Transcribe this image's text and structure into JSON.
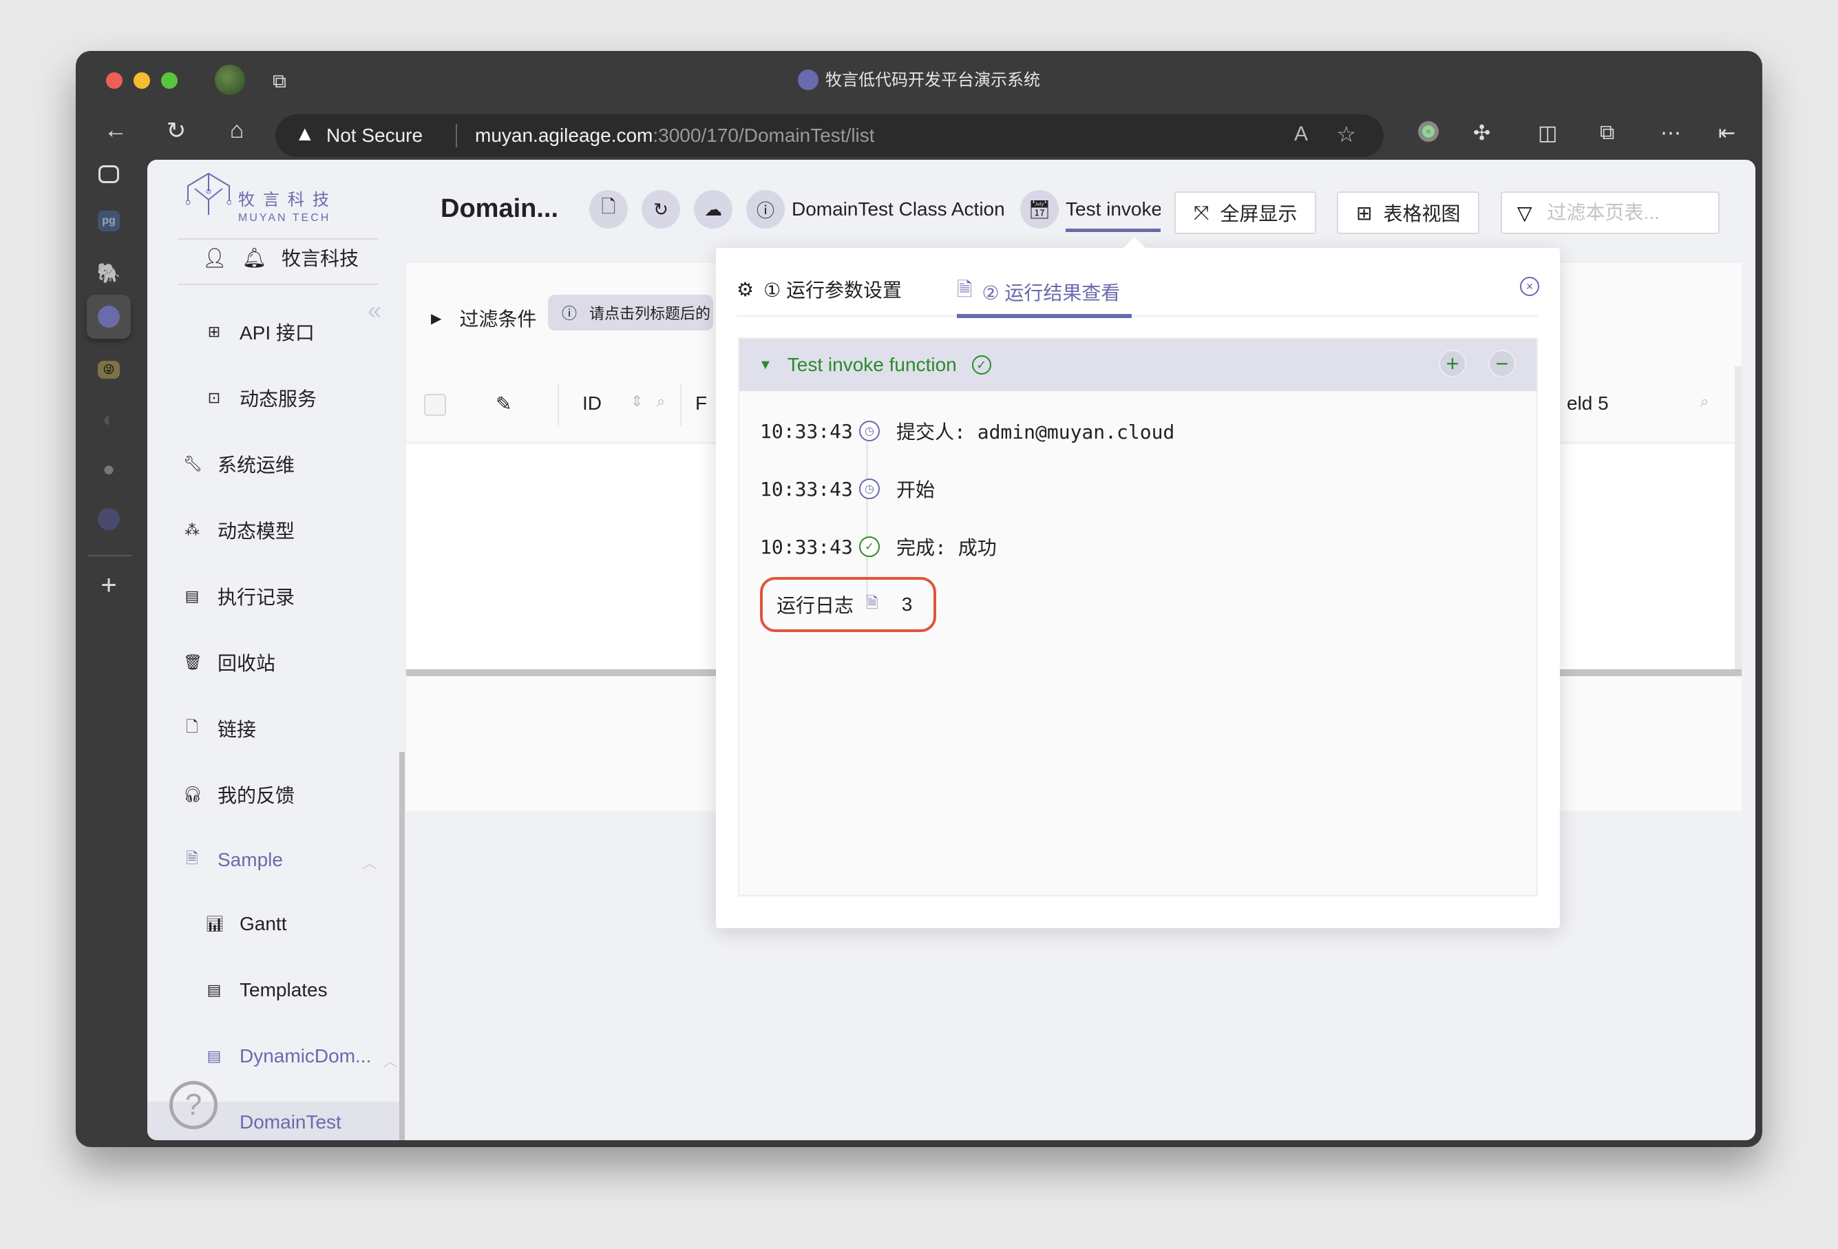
{
  "browser": {
    "window_title": "牧言低代码开发平台演示系统",
    "security_label": "Not Secure",
    "url_host": "muyan.agileage.com",
    "url_path": ":3000/170/DomainTest/list"
  },
  "vertical_tabs": [
    "sidebar-toggle",
    "pg",
    "postgres",
    "muyan",
    "emoji",
    "chat",
    "github",
    "muyan-2",
    "new-tab"
  ],
  "sidebar": {
    "logo_cn": "牧言科技",
    "logo_en": "MUYAN TECH",
    "user_name": "牧言科技",
    "items": [
      {
        "label": "API 接口",
        "icon": "sliders-icon",
        "level": "sub"
      },
      {
        "label": "动态服务",
        "icon": "terminal-icon",
        "level": "sub"
      },
      {
        "label": "系统运维",
        "icon": "wrench-icon",
        "level": "top"
      },
      {
        "label": "动态模型",
        "icon": "nodes-icon",
        "level": "top"
      },
      {
        "label": "执行记录",
        "icon": "clipboard-icon",
        "level": "top"
      },
      {
        "label": "回收站",
        "icon": "trash-icon",
        "level": "top"
      },
      {
        "label": "链接",
        "icon": "file-link-icon",
        "level": "top"
      },
      {
        "label": "我的反馈",
        "icon": "headphones-icon",
        "level": "top"
      },
      {
        "label": "Sample",
        "icon": "document-icon",
        "level": "top",
        "expanded": true
      },
      {
        "label": "Gantt",
        "icon": "bar-chart-icon",
        "level": "sub"
      },
      {
        "label": "Templates",
        "icon": "template-icon",
        "level": "sub"
      },
      {
        "label": "DynamicDom...",
        "icon": "template-icon",
        "level": "sub",
        "expanded": true
      },
      {
        "label": "DomainTest",
        "level": "sub",
        "active": true
      }
    ]
  },
  "header": {
    "title": "Domain...",
    "actions": [
      {
        "name": "new",
        "icon": "file-plus-icon"
      },
      {
        "name": "refresh",
        "icon": "refresh-icon"
      },
      {
        "name": "upload",
        "icon": "cloud-upload-icon"
      }
    ],
    "class_action_label": "DomainTest Class Action",
    "test_invoke_label": "Test invoke",
    "fullscreen_label": "全屏显示",
    "table_view_label": "表格视图",
    "filter_placeholder": "过滤本页表..."
  },
  "list": {
    "filter_label": "过滤条件",
    "hint_text": "请点击列标题后的",
    "columns": [
      "ID",
      "F",
      "eld 5"
    ]
  },
  "popup": {
    "tab1_label": "① 运行参数设置",
    "tab2_label": "② 运行结果查看",
    "active_tab": 2,
    "result_title": "Test invoke function",
    "result_status": "success",
    "timeline": [
      {
        "time": "10:33:43",
        "icon": "clock-icon",
        "text": "提交人: admin@muyan.cloud"
      },
      {
        "time": "10:33:43",
        "icon": "clock-icon",
        "text": "开始"
      },
      {
        "time": "10:33:43",
        "icon": "check-circle-icon",
        "text": "完成: 成功"
      }
    ],
    "log_label": "运行日志",
    "log_count": "3"
  },
  "colors": {
    "accent": "#6a6bac",
    "success": "#2b8a2b",
    "highlight": "#e2553a"
  }
}
